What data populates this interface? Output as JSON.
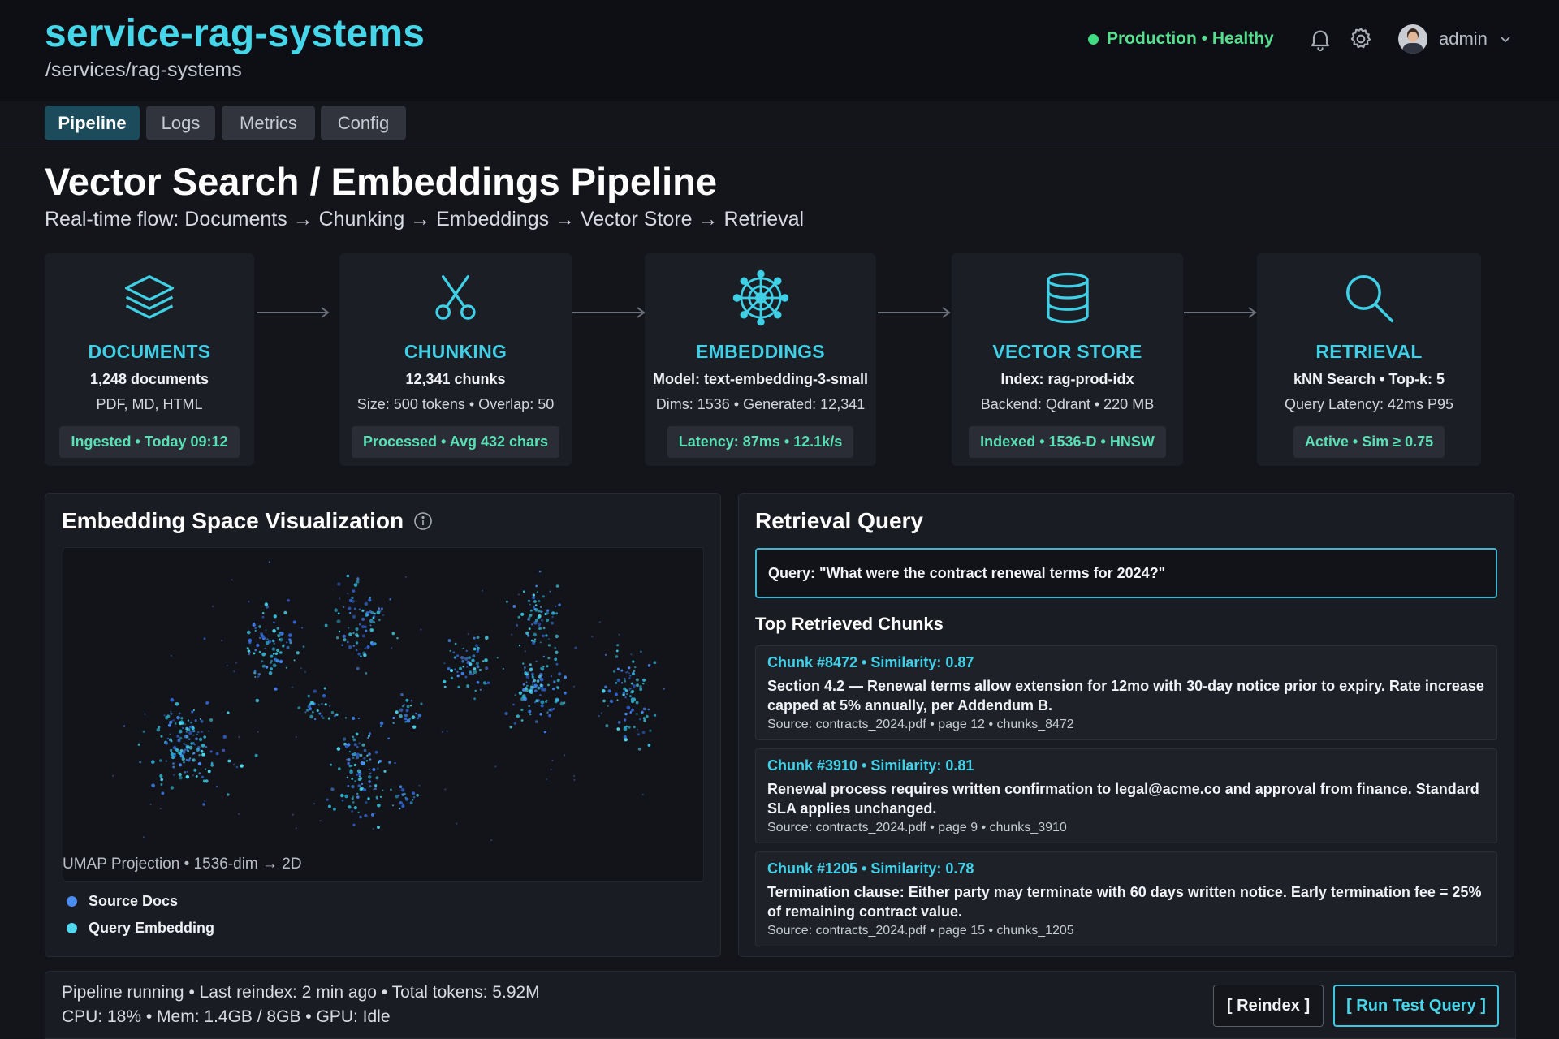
{
  "header": {
    "app_title": "service-rag-systems",
    "breadcrumb": "/services/rag-systems",
    "status": "Production • Healthy",
    "user": "admin"
  },
  "tabs": [
    {
      "label": "Pipeline",
      "active": true
    },
    {
      "label": "Logs",
      "active": false
    },
    {
      "label": "Metrics",
      "active": false
    },
    {
      "label": "Config",
      "active": false
    }
  ],
  "page": {
    "title": "Vector Search / Embeddings Pipeline",
    "subtitle": "Real-time flow: Documents → Chunking → Embeddings → Vector Store → Retrieval"
  },
  "pipeline": [
    {
      "icon": "layers-icon",
      "name": "DOCUMENTS",
      "line1": "1,248 documents",
      "line2": "PDF, MD, HTML",
      "badge": "Ingested • Today 09:12"
    },
    {
      "icon": "scissors-icon",
      "name": "CHUNKING",
      "line1": "12,341 chunks",
      "line2": "Size: 500 tokens • Overlap: 50",
      "badge": "Processed • Avg 432 chars"
    },
    {
      "icon": "network-icon",
      "name": "EMBEDDINGS",
      "line1": "Model: text-embedding-3-small",
      "line2": "Dims: 1536 • Generated: 12,341",
      "badge": "Latency: 87ms • 12.1k/s"
    },
    {
      "icon": "database-icon",
      "name": "VECTOR STORE",
      "line1": "Index: rag-prod-idx",
      "line2": "Backend: Qdrant • 220 MB",
      "badge": "Indexed • 1536-D • HNSW"
    },
    {
      "icon": "search-icon",
      "name": "RETRIEVAL",
      "line1": "kNN Search • Top-k: 5",
      "line2": "Query Latency: 42ms P95",
      "badge": "Active • Sim ≥ 0.75"
    }
  ],
  "visualization": {
    "title": "Embedding Space Visualization",
    "projection_label": "UMAP Projection • 1536-dim → 2D",
    "legend": [
      {
        "label": "Source Docs",
        "color": "#4a8cf0"
      },
      {
        "label": "Query Embedding",
        "color": "#4fd8f0"
      }
    ]
  },
  "retrieval": {
    "title": "Retrieval Query",
    "query": "Query: \"What were the contract renewal terms for 2024?\"",
    "chunks_heading": "Top Retrieved Chunks",
    "chunks": [
      {
        "head": "Chunk #8472 • Similarity: 0.87",
        "text": "Section 4.2 — Renewal terms allow extension for 12mo with 30-day notice prior to expiry. Rate increase capped at 5% annually, per Addendum B.",
        "source": "Source: contracts_2024.pdf • page 12 • chunks_8472"
      },
      {
        "head": "Chunk #3910 • Similarity: 0.81",
        "text": "Renewal process requires written confirmation to legal@acme.co and approval from finance. Standard SLA applies unchanged.",
        "source": "Source: contracts_2024.pdf • page 9 • chunks_3910"
      },
      {
        "head": "Chunk #1205 • Similarity: 0.78",
        "text": "Termination clause: Either party may terminate with 60 days written notice. Early termination fee = 25% of remaining contract value.",
        "source": "Source: contracts_2024.pdf • page 15 • chunks_1205"
      }
    ]
  },
  "footer": {
    "line1": "Pipeline running • Last reindex: 2 min ago • Total tokens: 5.92M",
    "line2": "CPU: 18% • Mem: 1.4GB / 8GB • GPU: Idle",
    "reindex_label": "[ Reindex ]",
    "run_label": "[ Run Test Query ]"
  },
  "colors": {
    "accent": "#46d6ea",
    "healthy": "#55e08f",
    "badge_text": "#59e0b4"
  }
}
